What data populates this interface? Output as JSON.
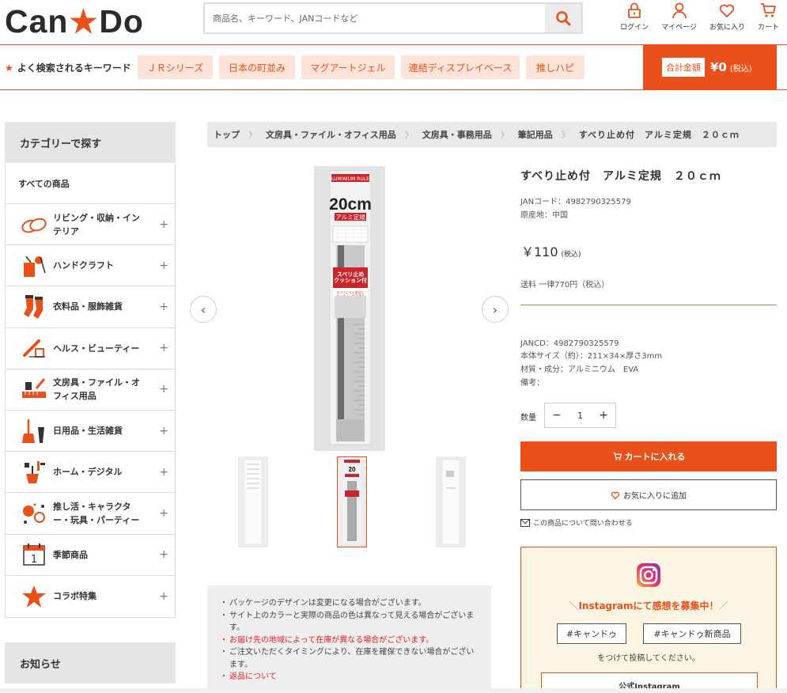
{
  "header": {
    "logo_left": "Can",
    "logo_star": "★",
    "logo_right": "Do",
    "search_placeholder": "商品名、キーワード、JANコードなど",
    "nav": [
      {
        "label": "ログイン",
        "icon": "lock-icon"
      },
      {
        "label": "マイページ",
        "icon": "user-icon"
      },
      {
        "label": "お気に入り",
        "icon": "heart-icon"
      },
      {
        "label": "カート",
        "icon": "cart-icon"
      }
    ]
  },
  "keywords": {
    "title": "よく検索されるキーワード",
    "chips": [
      "ＪＲシリーズ",
      "日本の町並み",
      "マグアートジェル",
      "連結ディスプレイベース",
      "推しハピ"
    ]
  },
  "cart_total": {
    "label": "合計金額",
    "value": "¥0",
    "tax": "(税込)"
  },
  "sidebar": {
    "title": "カテゴリーで探す",
    "all_label": "すべての商品",
    "categories": [
      {
        "label": "リビング・収納・インテリア",
        "icon": "living-icon"
      },
      {
        "label": "ハンドクラフト",
        "icon": "handcraft-icon"
      },
      {
        "label": "衣料品・服飾雑貨",
        "icon": "socks-icon"
      },
      {
        "label": "ヘルス・ビューティー",
        "icon": "beauty-icon"
      },
      {
        "label": "文房具・ファイル・オフィス用品",
        "icon": "stationery-icon"
      },
      {
        "label": "日用品・生活雑貨",
        "icon": "broom-icon"
      },
      {
        "label": "ホーム・デジタル",
        "icon": "home-tools-icon"
      },
      {
        "label": "推し活・キャラクター・玩具・パーティー",
        "icon": "party-icon"
      },
      {
        "label": "季節商品",
        "icon": "calendar-icon"
      },
      {
        "label": "コラボ特集",
        "icon": "star-icon"
      }
    ],
    "news_title": "お知らせ"
  },
  "breadcrumb": [
    "トップ",
    "文房具・ファイル・オフィス用品",
    "文房具・事務用品",
    "筆記用品",
    "すべり止め付　アルミ定規　２０ｃｍ"
  ],
  "gallery": {
    "package_top": "ALUMINIUM RULER",
    "package_size": "20cm",
    "package_type": "アルミ定規",
    "package_feature": "スベリ止め\nクッション付",
    "package_sub": "スベリにくく安全に\nカッティングできる"
  },
  "product": {
    "title": "すべり止め付　アルミ定規　２０ｃｍ",
    "jan": "JANコード：4982790325579",
    "origin": "原産地：中国",
    "price": "￥110",
    "price_tax": "(税込)",
    "shipping": "送料 一律770円（税込）",
    "spec_jan": "JANCD：4982790325579",
    "spec_size": "本体サイズ（約）：211×34×厚さ3mm",
    "spec_material": "材質・成分：アルミニウム　EVA",
    "spec_note": "備考：",
    "qty_label": "数量",
    "qty_value": "1",
    "add_to_cart": "カートに入れる",
    "add_to_favorite": "お気に入りに追加",
    "contact": "この商品について問い合わせる"
  },
  "notes": [
    {
      "text": "パッケージのデザインは変更になる場合がございます。",
      "red": false
    },
    {
      "text": "サイト上のカラーと実際の商品の色は異なって見える場合がございます。",
      "red": false
    },
    {
      "text": "お届け先の地域によって在庫が異なる場合がございます。",
      "red": true
    },
    {
      "text": "ご注文いただくタイミングにより、在庫を確保できない場合がございます。",
      "red": false
    },
    {
      "text": "返品について",
      "red": true
    }
  ],
  "instagram": {
    "heading": "Instagramにて感想を募集中！",
    "tags": [
      "#キャンドゥ",
      "#キャンドゥ新商品"
    ],
    "text": "をつけて投稿してください。",
    "button": "公式Instagram"
  },
  "colors": {
    "brand": "#e9501a",
    "chip_bg": "#fde3d8",
    "notice_red": "#e31e1e"
  }
}
